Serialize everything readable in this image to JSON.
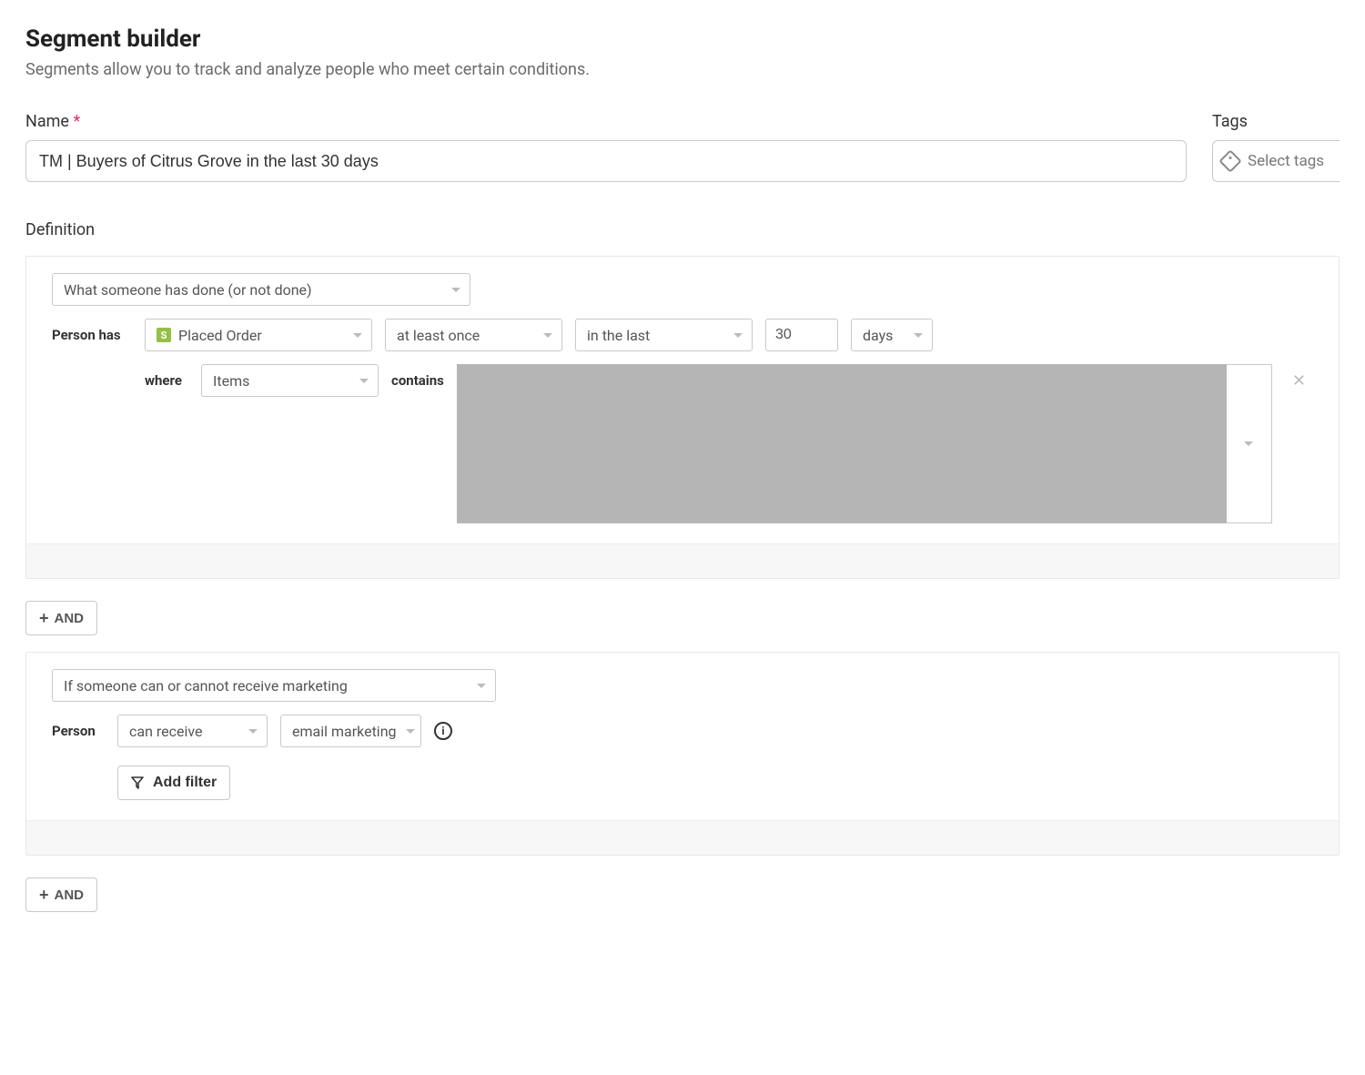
{
  "header": {
    "title": "Segment builder",
    "subtitle": "Segments allow you to track and analyze people who meet certain conditions."
  },
  "name_field": {
    "label": "Name",
    "required_mark": "*",
    "value": "TM | Buyers of Citrus Grove in the last 30 days"
  },
  "tags_field": {
    "label": "Tags",
    "placeholder": "Select tags"
  },
  "definition": {
    "label": "Definition"
  },
  "condition1": {
    "type_select": "What someone has done (or not done)",
    "row1": {
      "label": "Person has",
      "event": "Placed Order",
      "frequency": "at least once",
      "timeframe": "in the last",
      "number": "30",
      "unit": "days"
    },
    "row2": {
      "where_label": "where",
      "property": "Items",
      "contains_label": "contains"
    }
  },
  "and_connector": "AND",
  "condition2": {
    "type_select": "If someone can or cannot receive marketing",
    "row1": {
      "label": "Person",
      "can": "can receive",
      "channel": "email marketing"
    },
    "add_filter_label": "Add filter"
  },
  "bottom_and": "AND"
}
